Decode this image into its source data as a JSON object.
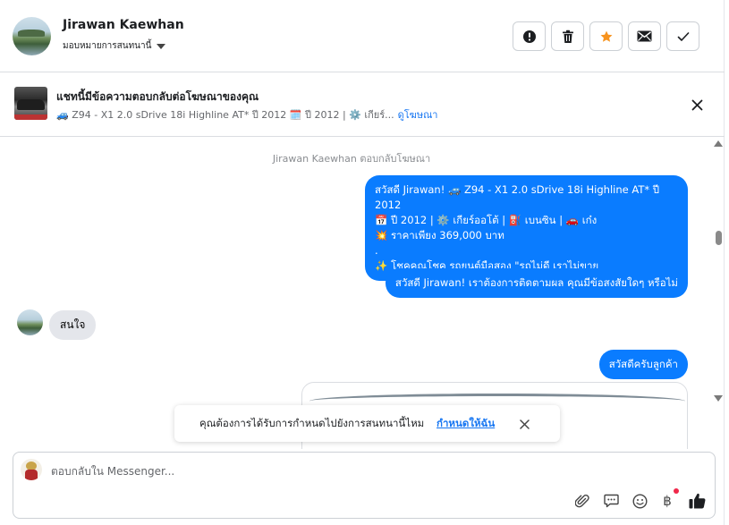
{
  "header": {
    "name": "Jirawan Kaewhan",
    "assign_label": "มอบหมายการสนทนานี้",
    "actions": {
      "spam": "alert-icon",
      "delete": "trash-icon",
      "star": "star-icon",
      "unread": "envelope-icon",
      "done": "checkmark-icon"
    }
  },
  "ad": {
    "title": "แชทนี้มีข้อความตอบกลับต่อโฆษณาของคุณ",
    "subtitle": "🚙 Z94 - X1 2.0 sDrive 18i Highline AT* ปี 2012 🗓️ ปี 2012 | ⚙️ เกียร์...",
    "link": "ดูโฆษณา"
  },
  "messages": {
    "system": "Jirawan Kaewhan ตอบกลับโฆษณา",
    "out1": {
      "line1": "สวัสดี Jirawan! 🚙 Z94 - X1 2.0 sDrive 18i Highline AT* ปี 2012",
      "line2": "📅 ปี 2012 | ⚙️ เกียร์ออโต้ | ⛽ เบนซิน | 🚗 เก๋ง",
      "line3": "💥 ราคาเพียง 369,000 บาท",
      "line4": ".",
      "line5": "✨ โชคคูณโชค รถยนต์มือสอง \"รถไม่ดี เราไม่ขาย"
    },
    "out2": "สวัสดี Jirawan! เราต้องการติดตามผล คุณมีข้อสงสัยใดๆ หรือไม่",
    "in1": "สนใจ",
    "out3": "สวัสดีครับลูกค้า"
  },
  "toast": {
    "text": "คุณต้องการได้รับการกำหนดไปยังการสนทนานี้ไหม",
    "link": "กำหนดให้ฉัน"
  },
  "composer": {
    "placeholder": "ตอบกลับใน Messenger...",
    "baht_symbol": "฿",
    "tools": [
      "paperclip-icon",
      "saved-reply-icon",
      "emoji-icon",
      "baht-icon",
      "thumbs-up-icon"
    ]
  },
  "colors": {
    "accent": "#0a7cff",
    "star": "#f7931e",
    "link": "#1877f2"
  }
}
